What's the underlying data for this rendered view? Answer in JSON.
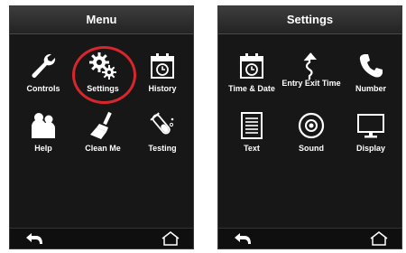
{
  "left_screen": {
    "title": "Menu",
    "items": [
      {
        "label": "Controls",
        "icon": "wrench-icon"
      },
      {
        "label": "Settings",
        "icon": "gears-icon",
        "highlighted": true
      },
      {
        "label": "History",
        "icon": "calendar-history-icon"
      },
      {
        "label": "Help",
        "icon": "people-icon"
      },
      {
        "label": "Clean Me",
        "icon": "brush-icon"
      },
      {
        "label": "Testing",
        "icon": "test-tube-icon"
      }
    ],
    "back_icon": "back-arrow-icon",
    "home_icon": "home-icon"
  },
  "right_screen": {
    "title": "Settings",
    "items": [
      {
        "label": "Time & Date",
        "icon": "calendar-clock-icon"
      },
      {
        "label": "Entry Exit Time",
        "icon": "route-arrow-icon"
      },
      {
        "label": "Number",
        "icon": "phone-icon"
      },
      {
        "label": "Text",
        "icon": "document-icon"
      },
      {
        "label": "Sound",
        "icon": "speaker-icon"
      },
      {
        "label": "Display",
        "icon": "monitor-icon"
      }
    ],
    "back_icon": "back-arrow-icon",
    "home_icon": "home-icon"
  },
  "colors": {
    "highlight": "#d8262c",
    "screen_bg": "#171717",
    "text": "#ffffff"
  }
}
